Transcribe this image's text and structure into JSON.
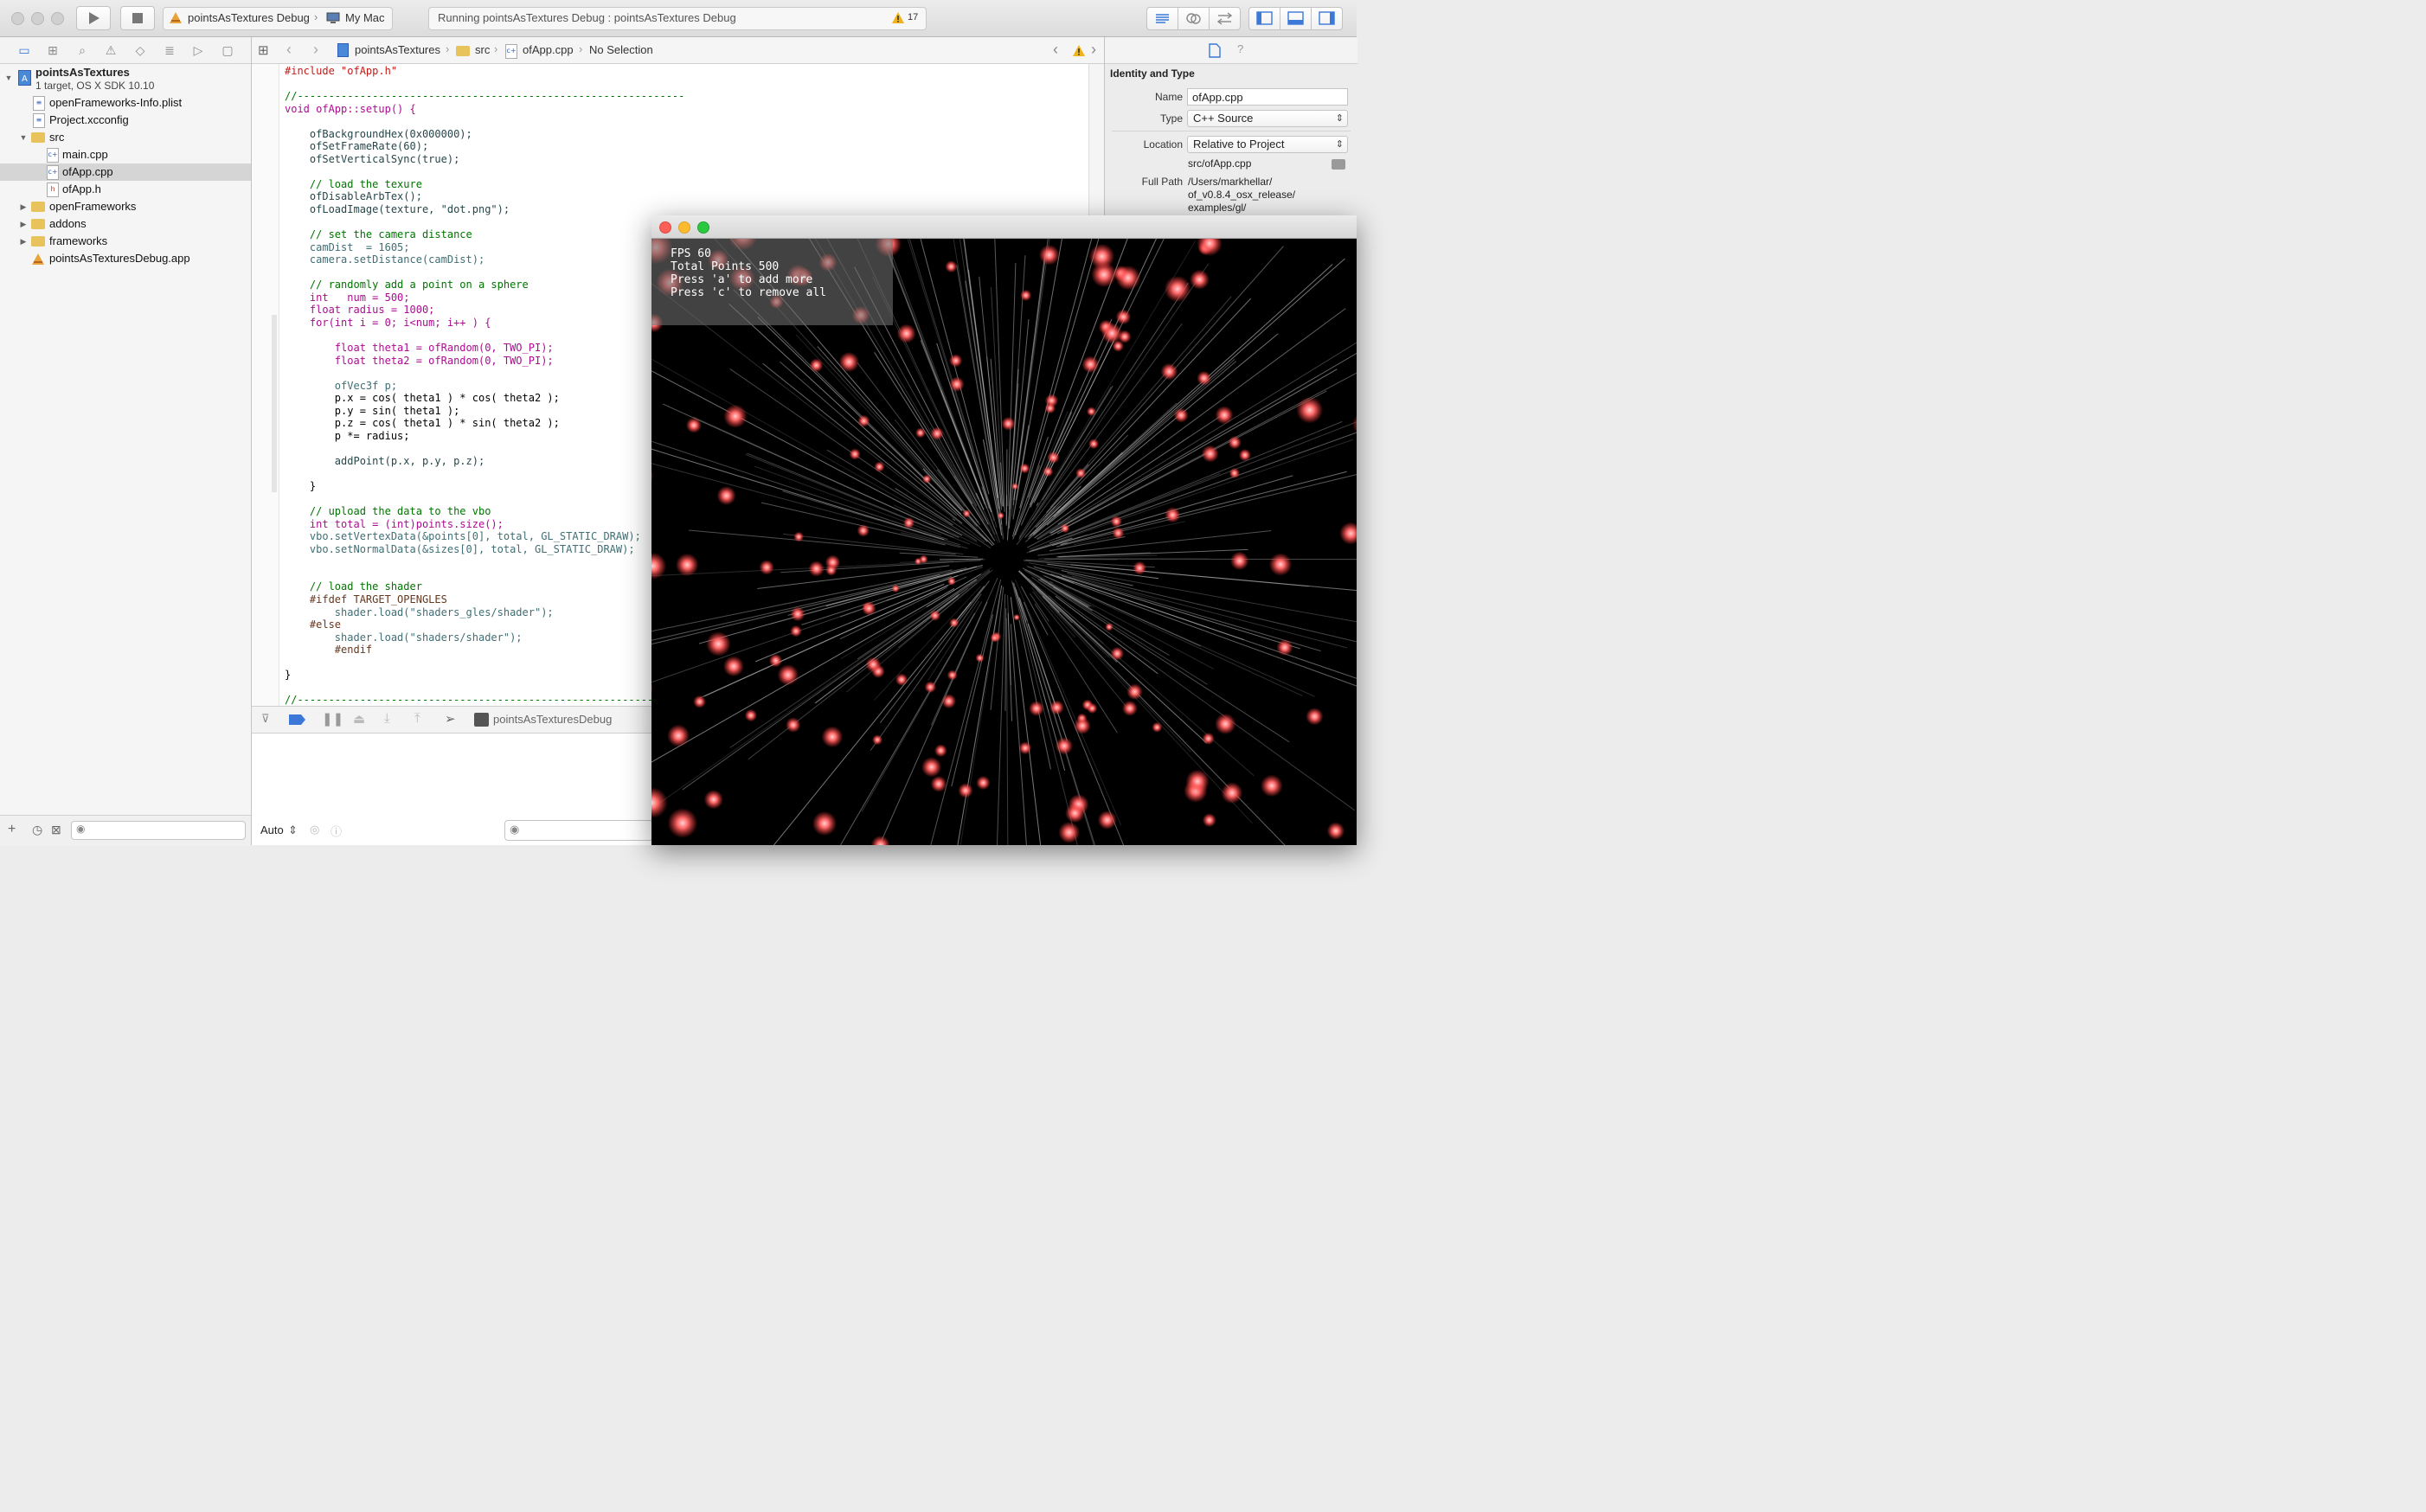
{
  "toolbar": {
    "scheme_target": "pointsAsTextures Debug",
    "scheme_device": "My Mac",
    "activity_status": "Running pointsAsTextures Debug : pointsAsTextures Debug",
    "warning_count": "17"
  },
  "navigator": {
    "project_name": "pointsAsTextures",
    "project_subtitle": "1 target, OS X SDK 10.10",
    "items": [
      {
        "label": "openFrameworks-Info.plist"
      },
      {
        "label": "Project.xcconfig"
      },
      {
        "label": "src"
      },
      {
        "label": "main.cpp"
      },
      {
        "label": "ofApp.cpp",
        "selected": true
      },
      {
        "label": "ofApp.h"
      },
      {
        "label": "openFrameworks"
      },
      {
        "label": "addons"
      },
      {
        "label": "frameworks"
      },
      {
        "label": "pointsAsTexturesDebug.app"
      }
    ]
  },
  "jumpbar": {
    "crumbs": [
      "pointsAsTextures",
      "src",
      "ofApp.cpp",
      "No Selection"
    ]
  },
  "editor": {
    "filename": "ofApp.cpp",
    "lines": [
      "#include \"ofApp.h\"",
      "",
      "//--------------------------------------------------------------",
      "void ofApp::setup() {",
      "",
      "    ofBackgroundHex(0x000000);",
      "    ofSetFrameRate(60);",
      "    ofSetVerticalSync(true);",
      "",
      "    // load the texure",
      "    ofDisableArbTex();",
      "    ofLoadImage(texture, \"dot.png\");",
      "",
      "    // set the camera distance",
      "    camDist  = 1605;",
      "    camera.setDistance(camDist);",
      "",
      "    // randomly add a point on a sphere",
      "    int   num = 500;",
      "    float radius = 1000;",
      "    for(int i = 0; i<num; i++ ) {",
      "",
      "        float theta1 = ofRandom(0, TWO_PI);",
      "        float theta2 = ofRandom(0, TWO_PI);",
      "",
      "        ofVec3f p;",
      "        p.x = cos( theta1 ) * cos( theta2 );",
      "        p.y = sin( theta1 );",
      "        p.z = cos( theta1 ) * sin( theta2 );",
      "        p *= radius;",
      "",
      "        addPoint(p.x, p.y, p.z);",
      "",
      "    }",
      "",
      "    // upload the data to the vbo",
      "    int total = (int)points.size();",
      "    vbo.setVertexData(&points[0], total, GL_STATIC_DRAW);",
      "    vbo.setNormalData(&sizes[0], total, GL_STATIC_DRAW);",
      "",
      "",
      "    // load the shader",
      "    #ifdef TARGET_OPENGLES",
      "        shader.load(\"shaders_gles/shader\");",
      "    #else",
      "        shader.load(\"shaders/shader\");",
      "        #endif",
      "",
      "}",
      "",
      "//--------------------------------------------------------------"
    ]
  },
  "debug": {
    "process_name": "pointsAsTexturesDebug",
    "console_mode": "Auto"
  },
  "inspector": {
    "section_title": "Identity and Type",
    "name_label": "Name",
    "name_value": "ofApp.cpp",
    "type_label": "Type",
    "type_value": "C++ Source",
    "location_label": "Location",
    "location_value": "Relative to Project",
    "relative_path": "src/ofApp.cpp",
    "fullpath_label": "Full Path",
    "fullpath_lines": [
      "/Users/markhellar/",
      "of_v0.8.4_osx_release/",
      "examples/gl/"
    ]
  },
  "app_window": {
    "overlay_lines": [
      "FPS 60",
      "Total Points 500",
      "Press 'a' to add more",
      "Press 'c' to remove all"
    ],
    "points_shown": 500,
    "colors": {
      "dot": "#ff5a5a",
      "streak": "#cfcfcf",
      "background": "#000000"
    }
  },
  "colors": {
    "keyword": "#aa0d91",
    "string": "#c41a16",
    "comment": "#007400",
    "number": "#1c00cf",
    "selection": "#d5d5d5"
  }
}
